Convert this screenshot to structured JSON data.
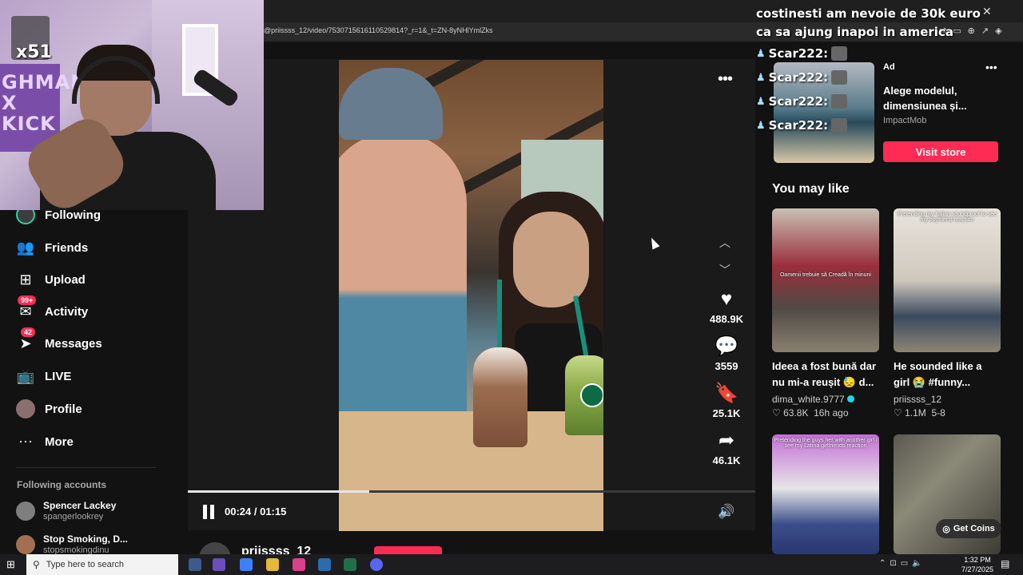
{
  "browser": {
    "url": "@priissss_12/video/7530715616110529814?_r=1&_t=ZN-8yNHlYmlZks",
    "toolbar_icons": [
      "translate-icon",
      "reader-icon",
      "zoom-icon",
      "share-icon",
      "extension-icon"
    ]
  },
  "webcam": {
    "badge_count": "x51",
    "poster_text": "GHMAN\nX\nKICK"
  },
  "sidebar": {
    "items": [
      {
        "label": "Following",
        "icon": "following-avatar-icon"
      },
      {
        "label": "Friends",
        "icon": "friends-icon"
      },
      {
        "label": "Upload",
        "icon": "upload-icon"
      },
      {
        "label": "Activity",
        "icon": "activity-icon",
        "badge": "99+"
      },
      {
        "label": "Messages",
        "icon": "messages-icon",
        "badge": "42"
      },
      {
        "label": "LIVE",
        "icon": "live-icon"
      },
      {
        "label": "Profile",
        "icon": "profile-avatar"
      },
      {
        "label": "More",
        "icon": "more-icon"
      }
    ],
    "following_title": "Following accounts",
    "following_accounts": [
      {
        "name": "Spencer Lackey",
        "handle": "spangerlookrey"
      },
      {
        "name": "Stop Smoking, D...",
        "handle": "stopsmokingdinu"
      }
    ]
  },
  "player": {
    "likes": "488.9K",
    "comments": "3559",
    "saves": "25.1K",
    "shares": "46.1K",
    "current_time": "00:24 / 01:15",
    "progress_fraction": 0.32,
    "author": "priissss_12"
  },
  "chat": {
    "top_message": "costinesti am nevoie de 30k euro ca sa ajung inapoi in america",
    "lines": [
      {
        "user": "Scar222:"
      },
      {
        "user": "Scar222:"
      },
      {
        "user": "Scar222:"
      },
      {
        "user": "Scar222:"
      }
    ]
  },
  "ad": {
    "label": "Ad",
    "title": "Alege modelul, dimensiunea și...",
    "sponsor": "ImpactMob",
    "cta": "Visit store"
  },
  "recommendations": {
    "title": "You may like",
    "items": [
      {
        "title": "Ideea a fost bună dar nu mi-a reușit 😓 d...",
        "author": "dima_white.9777",
        "verified": true,
        "likes": "♡ 63.8K",
        "date": "16h ago",
        "overlay": "Oamenii trebuie să Creadă în minuni"
      },
      {
        "title": "He sounded like a girl 😭 #funny...",
        "author": "priissss_12",
        "verified": false,
        "likes": "♡ 1.1M",
        "date": "5-8",
        "overlay": "Pretending my Italian soundproof to see my boyfriend reaction"
      },
      {
        "title": "",
        "author": "",
        "verified": false,
        "likes": "",
        "date": "",
        "overlay": "Pretending the guys her with another girl I see my Latina girlfriends reaction"
      },
      {
        "title": "",
        "author": "",
        "verified": false,
        "likes": "",
        "date": "",
        "overlay": ""
      }
    ],
    "get_coins": "Get Coins"
  },
  "taskbar": {
    "search_placeholder": "Type here to search",
    "time": "1:32 PM",
    "date": "7/27/2025"
  },
  "colors": {
    "accent": "#fe2c55",
    "background": "#121212",
    "verified": "#20d5ec"
  }
}
